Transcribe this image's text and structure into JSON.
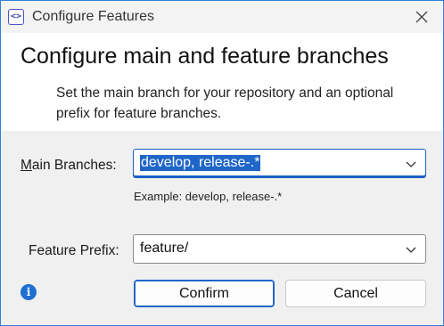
{
  "window": {
    "title": "Configure Features",
    "app_icon_glyph": "<>",
    "accent_color": "#2f7fd6"
  },
  "header": {
    "heading": "Configure main and feature branches",
    "description": "Set the main branch for your repository and an optional prefix for feature branches."
  },
  "form": {
    "main_branches": {
      "label_mnemonic": "M",
      "label_rest": "ain Branches:",
      "value": "develop, release-.*",
      "example": "Example: develop, release-.*"
    },
    "feature_prefix": {
      "label": "Feature Prefix:",
      "value": "feature/"
    }
  },
  "buttons": {
    "confirm": "Confirm",
    "cancel": "Cancel"
  },
  "icons": {
    "info": "info-icon",
    "close": "close-icon",
    "chevron": "chevron-down-icon"
  }
}
